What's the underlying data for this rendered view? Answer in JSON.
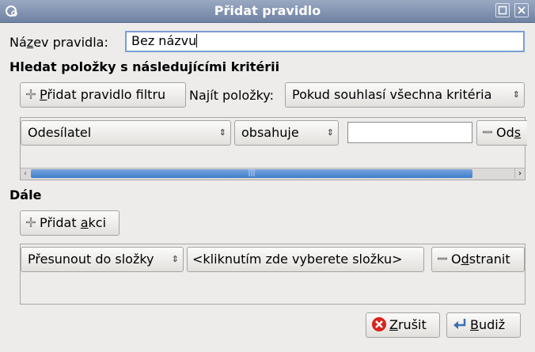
{
  "window": {
    "title": "Přidat pravidlo"
  },
  "name_row": {
    "label_pre": "Ná",
    "label_u": "z",
    "label_post": "ev pravidla:",
    "value": "Bez názvu"
  },
  "criteria": {
    "heading": "Hledat položky s následujícími kritérii",
    "add_filter_pre": "",
    "add_filter_u": "P",
    "add_filter_post": "řidat pravidlo filtru",
    "find_label": "Najít položky:",
    "find_value": "Pokud souhlasí všechna kritéria",
    "rule": {
      "field": "Odesílatel",
      "op": "obsahuje",
      "value": "",
      "remove_pre": "Od",
      "remove_u": "s"
    }
  },
  "actions": {
    "heading": "Dále",
    "add_action_pre": "Přidat ",
    "add_action_u": "a",
    "add_action_post": "kci",
    "row": {
      "action": "Přesunout do složky",
      "folder": "<kliknutím zde vyberete složku>",
      "remove_pre": "O",
      "remove_u": "d",
      "remove_post": "stranit"
    }
  },
  "footer": {
    "cancel_pre": "",
    "cancel_u": "Z",
    "cancel_post": "rušit",
    "ok_pre": "",
    "ok_u": "B",
    "ok_post": "udiž"
  },
  "colors": {
    "titlebar": "#7f91b1",
    "accent": "#3d7dc9",
    "cancel_icon": "#d9231d"
  }
}
